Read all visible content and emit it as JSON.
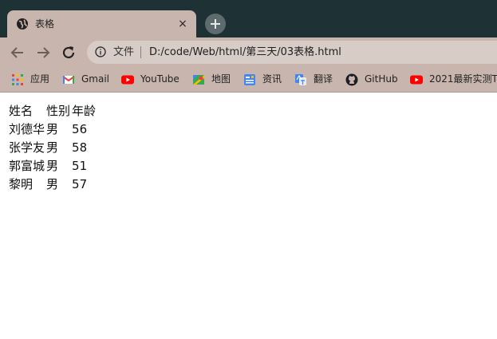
{
  "tab": {
    "title": "表格",
    "close_symbol": "×"
  },
  "omnibox": {
    "scheme_label": "文件",
    "url": "D:/code/Web/html/第三天/03表格.html"
  },
  "bookmarks": [
    {
      "label": "应用",
      "icon": "apps-grid-icon"
    },
    {
      "label": "Gmail",
      "icon": "gmail-icon"
    },
    {
      "label": "YouTube",
      "icon": "youtube-icon"
    },
    {
      "label": "地图",
      "icon": "maps-icon"
    },
    {
      "label": "资讯",
      "icon": "news-icon"
    },
    {
      "label": "翻译",
      "icon": "translate-icon"
    },
    {
      "label": "GitHub",
      "icon": "github-icon"
    },
    {
      "label": "2021最新实测T",
      "icon": "youtube-icon"
    }
  ],
  "table": {
    "headers": [
      "姓名",
      "性别",
      "年龄"
    ],
    "rows": [
      [
        "刘德华",
        "男",
        "56"
      ],
      [
        "张学友",
        "男",
        "58"
      ],
      [
        "郭富城",
        "男",
        "51"
      ],
      [
        "黎明",
        "男",
        "57"
      ]
    ]
  }
}
